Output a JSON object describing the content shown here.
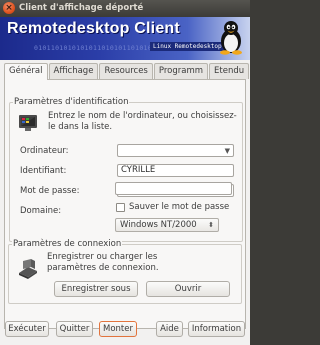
{
  "window": {
    "title": "Client d'affichage déporté"
  },
  "banner": {
    "brand": "Remotedesktop Client",
    "bits": "0101101010101011010101101010110101101",
    "subtitle": "Linux Remotedesktop"
  },
  "tabs": [
    {
      "label": "Général",
      "active": true
    },
    {
      "label": "Affichage",
      "active": false
    },
    {
      "label": "Resources",
      "active": false
    },
    {
      "label": "Programm",
      "active": false
    },
    {
      "label": "Etendu",
      "active": false
    }
  ],
  "identification": {
    "group_title": "Paramètres d'identification",
    "description": "Entrez le nom de l'ordinateur, ou choisissez-le dans la liste.",
    "computer_label": "Ordinateur:",
    "computer_value": "",
    "user_label": "Identifiant:",
    "user_value": "CYRILLE",
    "password_label": "Mot de passe:",
    "password_value": "",
    "domain_label": "Domaine:",
    "domain_value": "",
    "save_password_label": "Sauver le mot de passe",
    "save_password_checked": false,
    "os_selected": "Windows NT/2000"
  },
  "connection": {
    "group_title": "Paramètres de connexion",
    "description": "Enregistrer ou charger les paramètres de connexion.",
    "save_as_label": "Enregistrer sous",
    "open_label": "Ouvrir"
  },
  "footer": {
    "execute_label": "Exécuter",
    "quit_label": "Quitter",
    "show_label": "Monter",
    "help_label": "Aide",
    "info_label": "Information"
  },
  "colors": {
    "banner_dark": "#1c2a8c",
    "focus_border": "#e2743d",
    "titlebar": "#3c3b37"
  }
}
